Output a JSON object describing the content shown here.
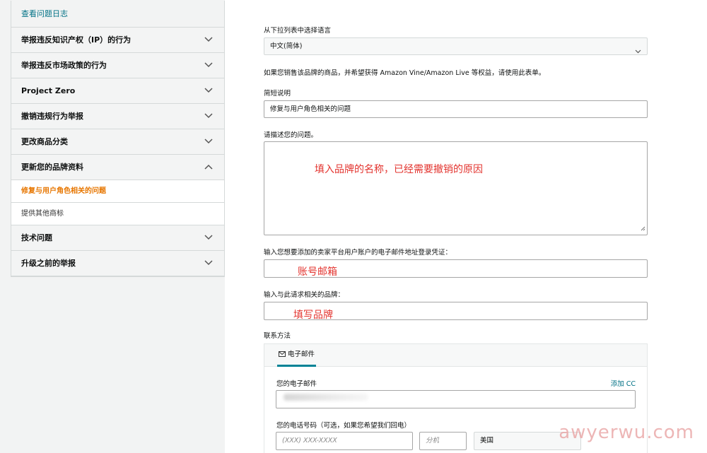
{
  "sidebar": {
    "view_log": "查看问题日志",
    "items": [
      {
        "label": "举报违反知识产权（IP）的行为"
      },
      {
        "label": "举报违反市场政策的行为"
      },
      {
        "label": "Project Zero"
      },
      {
        "label": "撤销违规行为举报"
      },
      {
        "label": "更改商品分类"
      },
      {
        "label": "更新您的品牌资料",
        "expanded": true
      }
    ],
    "subitems": [
      {
        "label": "修复与用户角色相关的问题",
        "active": true
      },
      {
        "label": "提供其他商标"
      }
    ],
    "items_after": [
      {
        "label": "技术问题"
      },
      {
        "label": "升级之前的举报"
      }
    ]
  },
  "form": {
    "language_label": "从下拉列表中选择语言",
    "language_value": "中文(简体)",
    "info_text": "如果您销售该品牌的商品，并希望获得 Amazon Vine/Amazon Live 等权益，请使用此表单。",
    "short_desc_label": "简短说明",
    "short_desc_value": "修复与用户角色相关的问题",
    "describe_label": "请描述您的问题。",
    "describe_annotation": "填入品牌的名称，已经需要撤销的原因",
    "email_creds_label": "输入您想要添加的卖家平台用户账户的电子邮件地址登录凭证：",
    "email_creds_annotation": "账号邮箱",
    "brand_label": "输入与此请求相关的品牌：",
    "brand_annotation": "填写品牌",
    "contact_label": "联系方法",
    "contact_tab": "电子邮件",
    "your_email_label": "您的电子邮件",
    "add_cc": "添加 CC",
    "phone_label": "您的电话号码（可选，如果您希望我们回电）",
    "phone_placeholder": "(XXX) XXX-XXXX",
    "ext_placeholder": "分机",
    "country_value": "美国"
  },
  "watermark": "awyerwu.com",
  "colors": {
    "link": "#007185",
    "active": "#e77600",
    "annotation": "#e3342f",
    "tab_underline": "#008296"
  }
}
